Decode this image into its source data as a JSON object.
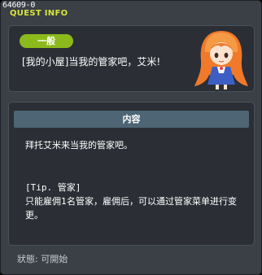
{
  "window": {
    "quest_id": "64609-0",
    "title": "QUEST INFO"
  },
  "quest": {
    "category": "一般",
    "name": "[我的小屋]当我的管家吧，艾米!",
    "npc_icon": "npc-portrait-icon"
  },
  "content": {
    "header": "内容",
    "description": "拜托艾米来当我的管家吧。",
    "tip_label": "[Tip. 管家]",
    "tip_text": "只能雇佣1名管家，雇佣后，可以通过管家菜单进行变更。"
  },
  "status": {
    "text": "狀態: 可開始"
  },
  "colors": {
    "window_bg": "#3b3f46",
    "panel_bg": "#2b2f35",
    "title": "#d9e63a",
    "badge": "#8cba1c",
    "section_header": "#4d6575"
  }
}
